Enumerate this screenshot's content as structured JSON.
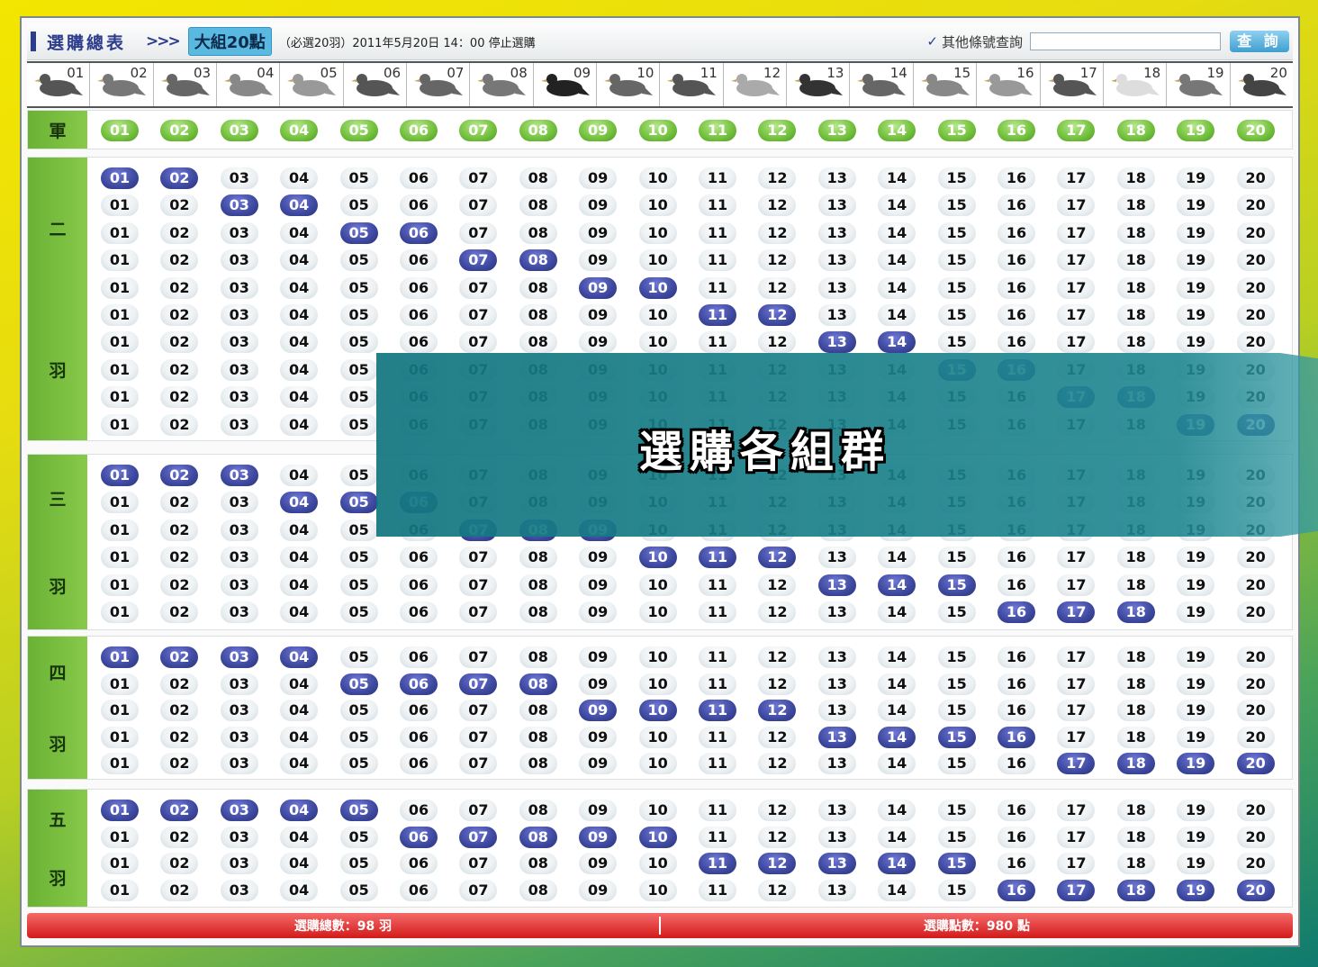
{
  "header": {
    "title": "選購總表",
    "arrows": ">>>",
    "group": "大組20點",
    "note": "（必選20羽）2011年5月20日 14：00 停止選購",
    "search_label": "其他條號查詢",
    "search_value": "",
    "search_button": "查 詢"
  },
  "pigeons": [
    "01",
    "02",
    "03",
    "04",
    "05",
    "06",
    "07",
    "08",
    "09",
    "10",
    "11",
    "12",
    "13",
    "14",
    "15",
    "16",
    "17",
    "18",
    "19",
    "20"
  ],
  "champion": {
    "label": "軍",
    "numbers": [
      "01",
      "02",
      "03",
      "04",
      "05",
      "06",
      "07",
      "08",
      "09",
      "10",
      "11",
      "12",
      "13",
      "14",
      "15",
      "16",
      "17",
      "18",
      "19",
      "20"
    ]
  },
  "sections": [
    {
      "label": [
        "二",
        "羽"
      ],
      "rows": 10,
      "picks": [
        [
          1,
          2
        ],
        [
          3,
          4
        ],
        [
          5,
          6
        ],
        [
          7,
          8
        ],
        [
          9,
          10
        ],
        [
          11,
          12
        ],
        [
          13,
          14
        ],
        [
          15,
          16
        ],
        [
          17,
          18
        ],
        [
          19,
          20
        ]
      ]
    },
    {
      "label": [
        "三",
        "羽"
      ],
      "rows": 6,
      "picks": [
        [
          1,
          2,
          3
        ],
        [
          4,
          5,
          6
        ],
        [
          7,
          8,
          9
        ],
        [
          10,
          11,
          12
        ],
        [
          13,
          14,
          15
        ],
        [
          16,
          17,
          18
        ]
      ]
    },
    {
      "label": [
        "四",
        "羽"
      ],
      "rows": 5,
      "picks": [
        [
          1,
          2,
          3,
          4
        ],
        [
          5,
          6,
          7,
          8
        ],
        [
          9,
          10,
          11,
          12
        ],
        [
          13,
          14,
          15,
          16
        ],
        [
          17,
          18,
          19,
          20
        ]
      ]
    },
    {
      "label": [
        "五",
        "羽"
      ],
      "rows": 4,
      "picks": [
        [
          1,
          2,
          3,
          4,
          5
        ],
        [
          6,
          7,
          8,
          9,
          10
        ],
        [
          11,
          12,
          13,
          14,
          15
        ],
        [
          16,
          17,
          18,
          19,
          20
        ]
      ]
    }
  ],
  "footer": {
    "total_label": "選購總數：98 羽",
    "points_label": "選購點數：980 點"
  },
  "overlay": {
    "text": "選購各組群"
  },
  "colors": {
    "selected": "#3d489f",
    "champion": "#72c03c",
    "footer": "#d31a1a",
    "label_green": "#7cc042"
  }
}
